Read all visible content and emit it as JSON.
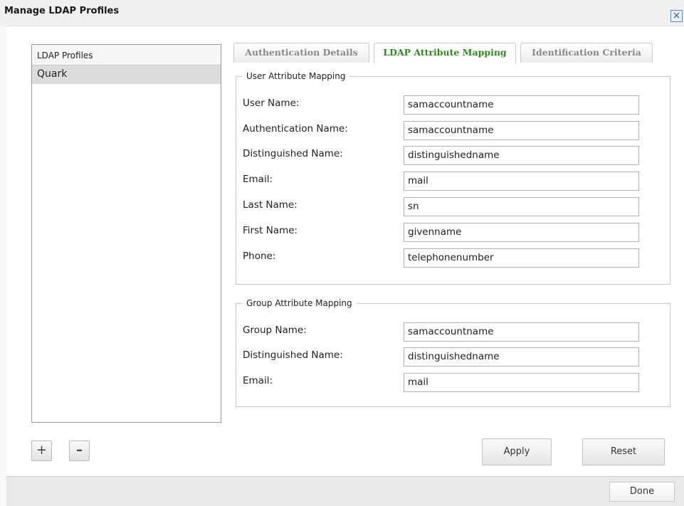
{
  "window": {
    "title": "Manage LDAP Profiles",
    "close_glyph": "×"
  },
  "profiles": {
    "header": "LDAP Profiles",
    "items": [
      "Quark"
    ],
    "add_label": "+",
    "remove_label": "–"
  },
  "tabs": [
    {
      "label": "Authentication Details",
      "active": false
    },
    {
      "label": "LDAP Attribute Mapping",
      "active": true
    },
    {
      "label": "Identification Criteria",
      "active": false
    }
  ],
  "user_mapping": {
    "legend": "User Attribute Mapping",
    "fields": [
      {
        "label": "User Name:",
        "value": "samaccountname"
      },
      {
        "label": "Authentication Name:",
        "value": "samaccountname"
      },
      {
        "label": "Distinguished Name:",
        "value": "distinguishedname"
      },
      {
        "label": "Email:",
        "value": "mail"
      },
      {
        "label": "Last Name:",
        "value": "sn"
      },
      {
        "label": "First Name:",
        "value": "givenname"
      },
      {
        "label": "Phone:",
        "value": "telephonenumber"
      }
    ]
  },
  "group_mapping": {
    "legend": "Group Attribute Mapping",
    "fields": [
      {
        "label": "Group Name:",
        "value": "samaccountname"
      },
      {
        "label": "Distinguished Name:",
        "value": "distinguishedname"
      },
      {
        "label": "Email:",
        "value": "mail"
      }
    ]
  },
  "buttons": {
    "apply": "Apply",
    "reset": "Reset",
    "done": "Done"
  },
  "colors": {
    "active_tab_text": "#2e8b1c",
    "close_icon": "#2b5aa8"
  }
}
